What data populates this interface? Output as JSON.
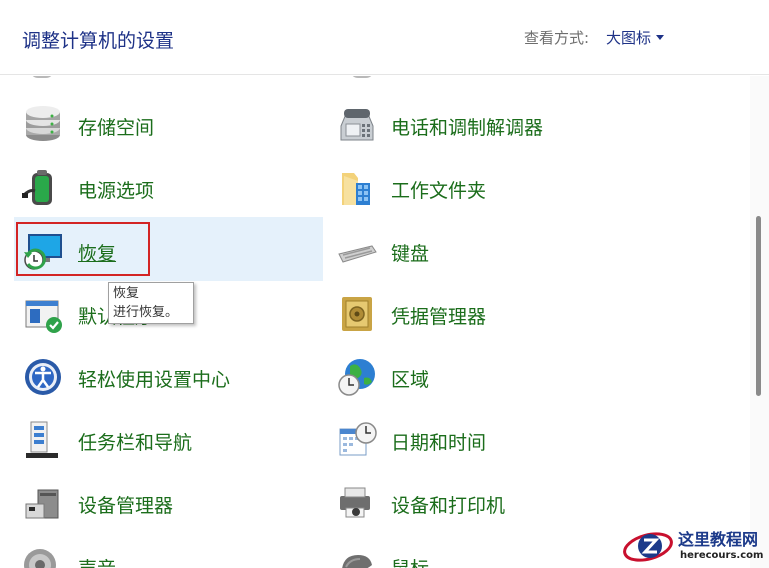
{
  "header": {
    "title": "调整计算机的设置",
    "view_label": "查看方式:",
    "view_value": "大图标"
  },
  "items": {
    "storage_spaces": "存储空间",
    "phone_modem": "电话和调制解调器",
    "power_options": "电源选项",
    "work_folders": "工作文件夹",
    "recovery": "恢复",
    "keyboard": "键盘",
    "default_programs": "默认程序",
    "credential_manager": "凭据管理器",
    "ease_of_access": "轻松使用设置中心",
    "region": "区域",
    "taskbar_nav": "任务栏和导航",
    "date_time": "日期和时间",
    "device_manager": "设备管理器",
    "devices_printers": "设备和打印机",
    "sound": "声音",
    "mouse": "鼠标"
  },
  "tooltip": {
    "title": "恢复",
    "desc": "进行恢复。"
  },
  "watermark": {
    "title": "这里教程网",
    "url": "herecours.com"
  },
  "colors": {
    "link_green": "#1b6d1b",
    "title_blue": "#1e3287",
    "hover_bg": "#e5f1fb",
    "highlight_red": "#d32424"
  }
}
